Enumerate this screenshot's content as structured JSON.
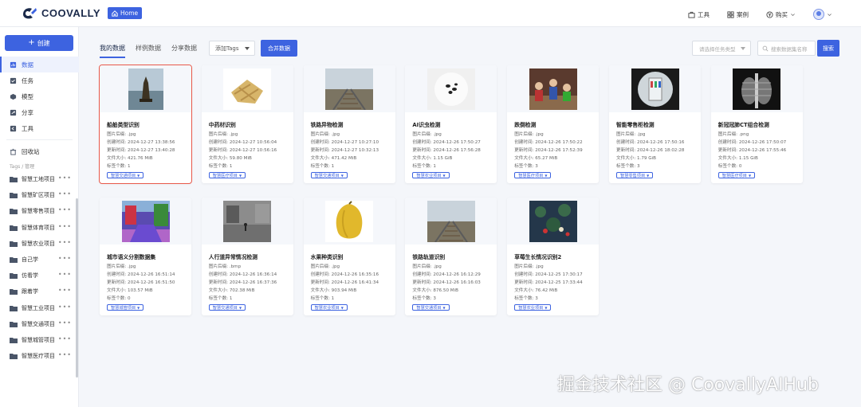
{
  "app": {
    "brand": "COOVALLY",
    "home_label": "Home"
  },
  "topbar": {
    "tools": "工具",
    "cases": "案例",
    "purchase": "购买"
  },
  "sidebar": {
    "create_label": "创建",
    "nav": [
      {
        "label": "数据",
        "icon": "data-icon",
        "active": true
      },
      {
        "label": "任务",
        "icon": "task-icon"
      },
      {
        "label": "模型",
        "icon": "model-icon"
      },
      {
        "label": "分享",
        "icon": "share-icon"
      },
      {
        "label": "工具",
        "icon": "tool-icon"
      },
      {
        "label": "回收站",
        "icon": "trash-icon"
      }
    ],
    "tags_label": "Tags / 管理",
    "projects": [
      "智慧工地项目",
      "智慧矿区项目",
      "智慧零售项目",
      "智慧体育项目",
      "智慧农业项目",
      "自己学",
      "仿看学",
      "跟着学",
      "智慧工业项目",
      "智慧交通项目",
      "智慧城管项目",
      "智慧医疗项目"
    ]
  },
  "toolbar": {
    "tabs": [
      "我的数据",
      "样例数据",
      "分享数据"
    ],
    "add_tags": "添加Tags",
    "merge": "合并数据",
    "filter_placeholder": "请选择任务类型",
    "search_placeholder": "搜索数据集名称",
    "search_btn": "搜索"
  },
  "colors": {
    "accent": "#3d63e0",
    "selected_border": "#e8594a"
  },
  "cards": [
    {
      "title": "船舶类型识别",
      "type": "图片后缀: .jpg",
      "created": "创建时间: 2024-12-27 13:38:56",
      "updated": "更新时间: 2024-12-27 13:40:28",
      "size": "文件大小: 421.76 MiB",
      "tags": "标签个数: 1",
      "badge": "智慧交通项目",
      "thumb": "boat"
    },
    {
      "title": "中药材识别",
      "type": "图片后缀: .jpg",
      "created": "创建时间: 2024-12-27 10:56:04",
      "updated": "更新时间: 2024-12-27 10:56:16",
      "size": "文件大小: 59.80 MiB",
      "tags": "标签个数: 1",
      "badge": "智慧医疗项目",
      "thumb": "herb"
    },
    {
      "title": "铁路异物检测",
      "type": "图片后缀: .jpg",
      "created": "创建时间: 2024-12-27 10:27:10",
      "updated": "更新时间: 2024-12-27 10:32:13",
      "size": "文件大小: 471.42 MiB",
      "tags": "标签个数: 1",
      "badge": "智慧交通项目",
      "thumb": "rail"
    },
    {
      "title": "AI识虫检测",
      "type": "图片后缀: .jpg",
      "created": "创建时间: 2024-12-26 17:50:27",
      "updated": "更新时间: 2024-12-26 17:56:28",
      "size": "文件大小: 1.15 GiB",
      "tags": "标签个数: 1",
      "badge": "智慧农业项目",
      "thumb": "bugs"
    },
    {
      "title": "跌倒检测",
      "type": "图片后缀: .jpg",
      "created": "创建时间: 2024-12-26 17:50:22",
      "updated": "更新时间: 2024-12-26 17:52:39",
      "size": "文件大小: 65.27 MiB",
      "tags": "标签个数: 3",
      "badge": "智慧医疗项目",
      "thumb": "crowd"
    },
    {
      "title": "智能零售柜检测",
      "type": "图片后缀: .jpg",
      "created": "创建时间: 2024-12-26 17:50:16",
      "updated": "更新时间: 2024-12-26 18:02:28",
      "size": "文件大小: 1.79 GiB",
      "tags": "标签个数: 3",
      "badge": "智慧零售项目",
      "thumb": "fridge"
    },
    {
      "title": "新冠冠肺CT组合检测",
      "type": "图片后缀: .png",
      "created": "创建时间: 2024-12-26 17:50:07",
      "updated": "更新时间: 2024-12-26 17:55:46",
      "size": "文件大小: 1.15 GiB",
      "tags": "标签个数: 0",
      "badge": "智慧医疗项目",
      "thumb": "xray"
    },
    {
      "title": "城市语义分割数据集",
      "type": "图片后缀: .jpg",
      "created": "创建时间: 2024-12-26 16:51:14",
      "updated": "更新时间: 2024-12-26 16:51:50",
      "size": "文件大小: 103.57 MiB",
      "tags": "标签个数: 0",
      "badge": "智慧城管项目",
      "thumb": "seg"
    },
    {
      "title": "人行道异常情况检测",
      "type": "图片后缀: .bmp",
      "created": "创建时间: 2024-12-26 16:36:14",
      "updated": "更新时间: 2024-12-26 16:37:36",
      "size": "文件大小: 702.38 MiB",
      "tags": "标签个数: 1",
      "badge": "智慧交通项目",
      "thumb": "walk"
    },
    {
      "title": "水果种类识别",
      "type": "图片后缀: .jpg",
      "created": "创建时间: 2024-12-26 16:35:16",
      "updated": "更新时间: 2024-12-26 16:41:34",
      "size": "文件大小: 903.94 MiB",
      "tags": "标签个数: 1",
      "badge": "智慧农业项目",
      "thumb": "fruit"
    },
    {
      "title": "铁路轨道识别",
      "type": "图片后缀: .jpg",
      "created": "创建时间: 2024-12-26 16:12:29",
      "updated": "更新时间: 2024-12-26 16:16:03",
      "size": "文件大小: 876.50 MiB",
      "tags": "标签个数: 3",
      "badge": "智慧交通项目",
      "thumb": "rail"
    },
    {
      "title": "草莓生长情况识别2",
      "type": "图片后缀: .jpg",
      "created": "创建时间: 2024-12-25 17:30:17",
      "updated": "更新时间: 2024-12-25 17:33:44",
      "size": "文件大小: 76.42 MiB",
      "tags": "标签个数: 3",
      "badge": "智慧农业项目",
      "thumb": "berry"
    }
  ],
  "watermark": "掘金技术社区 @ CoovallyAIHub"
}
